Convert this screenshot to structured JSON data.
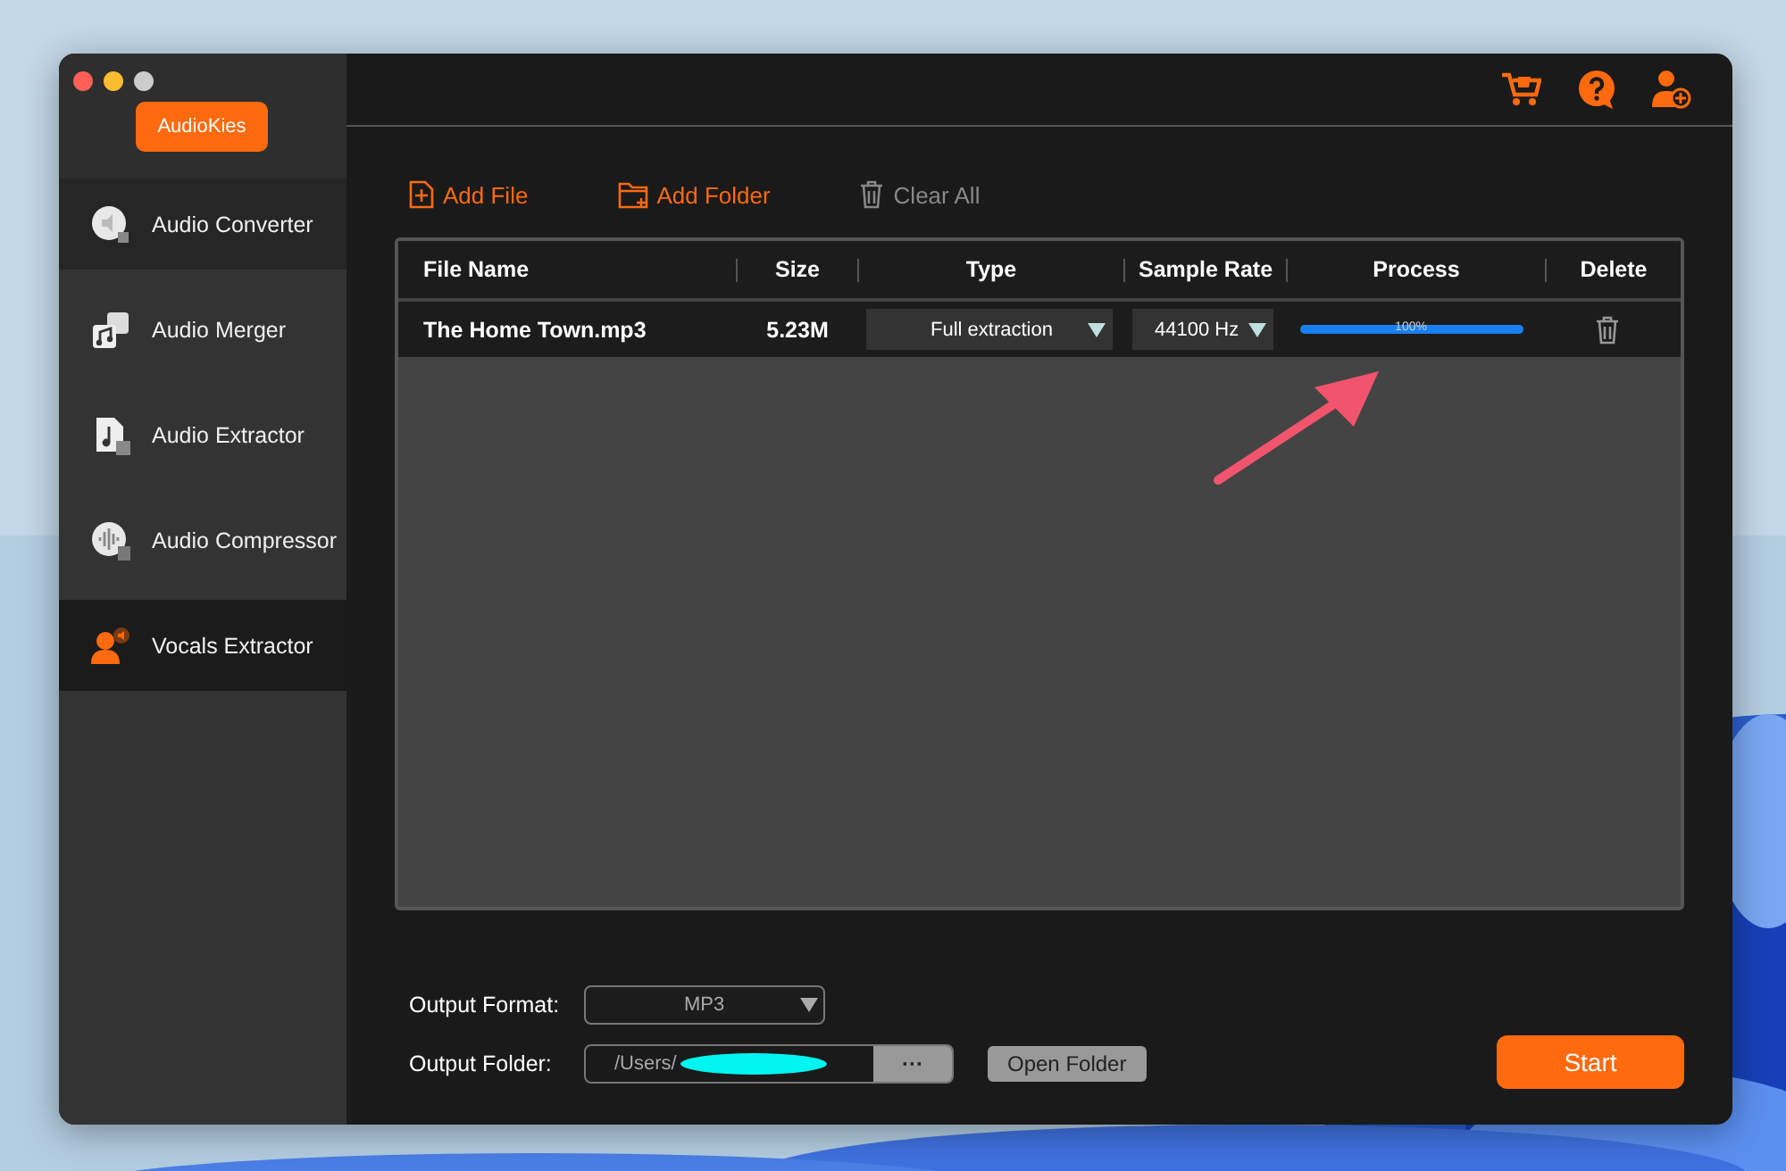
{
  "app": {
    "name": "AudioKies"
  },
  "sidebar": {
    "items": [
      {
        "label": "Audio Converter",
        "kind": "converter",
        "selected": false,
        "hovered": true
      },
      {
        "label": "Audio Merger",
        "kind": "merger",
        "selected": false,
        "hovered": false
      },
      {
        "label": "Audio Extractor",
        "kind": "extractor",
        "selected": false,
        "hovered": false
      },
      {
        "label": "Audio Compressor",
        "kind": "compressor",
        "selected": false,
        "hovered": false
      },
      {
        "label": "Vocals Extractor",
        "kind": "vocals",
        "selected": true,
        "hovered": false
      }
    ]
  },
  "toolbar": [
    {
      "label": "Add File",
      "kind": "file",
      "disabled": false
    },
    {
      "label": "Add Folder",
      "kind": "folder",
      "disabled": false
    },
    {
      "label": "Clear All",
      "kind": "clear",
      "disabled": true
    }
  ],
  "table": {
    "columns": [
      "File Name",
      "Size",
      "Type",
      "Sample Rate",
      "Process",
      "Delete"
    ],
    "rows": [
      {
        "file_name": "The Home Town.mp3",
        "size": "5.23M",
        "type": "Full extraction",
        "sample_rate": "44100 Hz",
        "level": 1,
        "reading": "100%"
      }
    ]
  },
  "output": {
    "format_label": "Output Format:",
    "format": "MP3",
    "folder_label": "Output Folder:",
    "folder": "/Users/",
    "browse": "···",
    "open_folder": "Open Folder"
  },
  "start_button": "Start"
}
